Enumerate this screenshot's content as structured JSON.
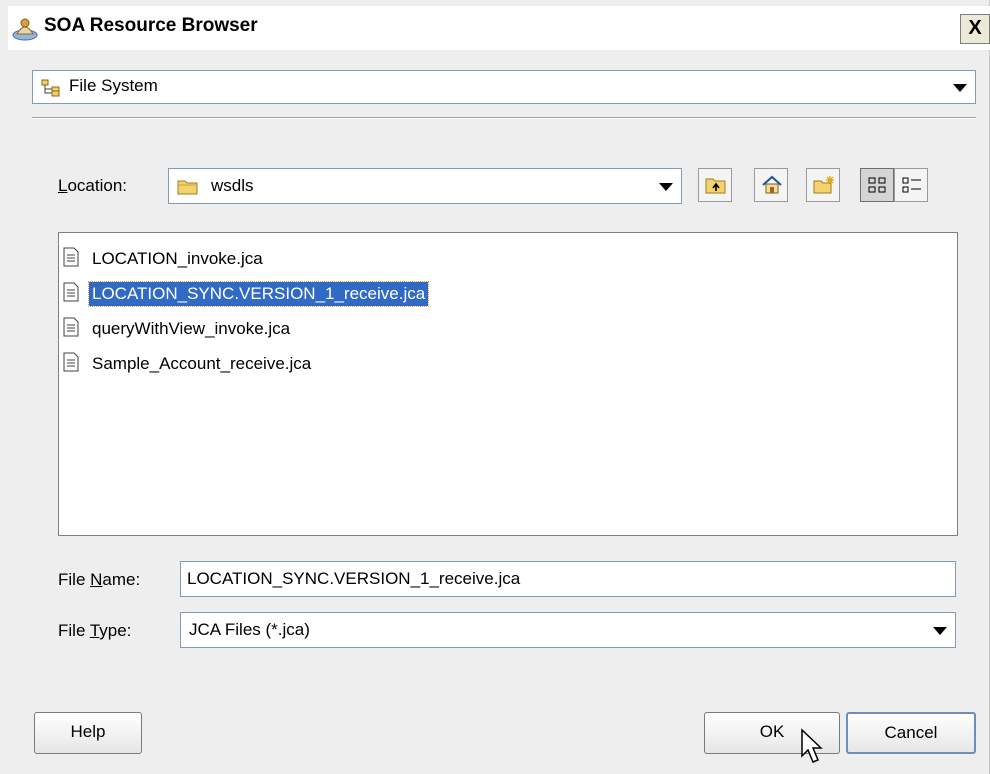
{
  "window": {
    "title": "SOA Resource Browser",
    "close_label": "X"
  },
  "source_selector": {
    "value": "File System",
    "icon": "file-system-tree-icon"
  },
  "location": {
    "label_prefix": "",
    "label_mnemonic": "L",
    "label_rest": "ocation:",
    "value": "wsdls",
    "icon": "folder-icon"
  },
  "toolbar": {
    "buttons": [
      {
        "name": "up-one-level",
        "icon": "folder-up-icon"
      },
      {
        "name": "home",
        "icon": "home-icon"
      },
      {
        "name": "new-folder",
        "icon": "new-folder-icon"
      },
      {
        "name": "icon-view",
        "icon": "icon-view-icon",
        "active": true
      },
      {
        "name": "list-view",
        "icon": "list-view-icon",
        "active": false
      }
    ]
  },
  "files": [
    {
      "name": "LOCATION_invoke.jca",
      "selected": false
    },
    {
      "name": "LOCATION_SYNC.VERSION_1_receive.jca",
      "selected": true
    },
    {
      "name": "queryWithView_invoke.jca",
      "selected": false
    },
    {
      "name": "Sample_Account_receive.jca",
      "selected": false
    }
  ],
  "file_name": {
    "label_prefix": "File ",
    "label_mnemonic": "N",
    "label_rest": "ame:",
    "value": "LOCATION_SYNC.VERSION_1_receive.jca"
  },
  "file_type": {
    "label_prefix": "File ",
    "label_mnemonic": "T",
    "label_rest": "ype:",
    "value": "JCA Files (*.jca)"
  },
  "buttons": {
    "help": "Help",
    "ok": "OK",
    "cancel": "Cancel"
  },
  "colors": {
    "selection": "#316ac5",
    "dialog_bg": "#eeeeee"
  }
}
